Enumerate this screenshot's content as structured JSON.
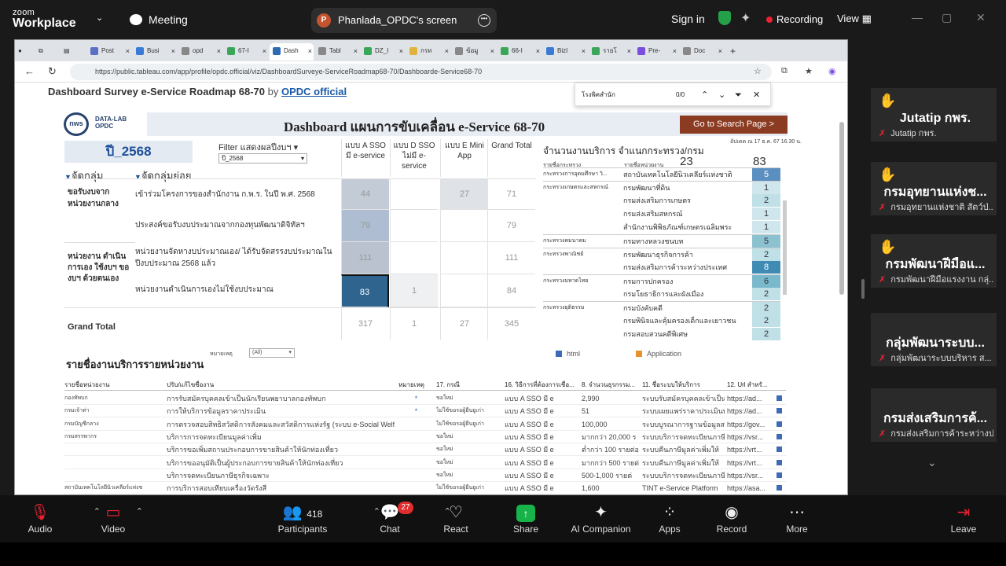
{
  "zoom": {
    "brand_top": "zoom",
    "brand_bottom": "Workplace",
    "meeting": "Meeting",
    "share_label": "Phanlada_OPDC's screen",
    "signin": "Sign in",
    "recording": "Recording",
    "view": "View"
  },
  "browser": {
    "tabs": [
      "Post",
      "Busi",
      "opd",
      "67-I",
      "Dash",
      "Tabl",
      "DZ_I",
      "กรท",
      "ข้อมู",
      "66-I",
      "BizI",
      "รายโ",
      "Pre-",
      "Doc"
    ],
    "url": "https://public.tableau.com/app/profile/opdc.official/viz/DashboardSurveye-ServiceRoadmap68-70/Dashboarde-Service68-70"
  },
  "viz": {
    "title": "Dashboard Survey e-Service Roadmap 68-70",
    "by": "by",
    "author": "OPDC official"
  },
  "find": {
    "query": "โรงพิคสำนัก",
    "count": "0/0"
  },
  "dash": {
    "logo": "nws",
    "logo_sub": "DATA-LAB\nOPDC",
    "title": "Dashboard แผนการขับเคลื่อน e-Service 68-70",
    "goto": "Go to Search Page >",
    "year": "ปี_2568",
    "filter_label": "Filter แสดงผลปีงบฯ",
    "filter_value": "ปี_2568",
    "grp1": "จัดกลุ่ม",
    "grp2": "จัดกลุ่มย่อย",
    "cols": [
      "แบบ A SSO มี e-service",
      "แบบ D SSO ไม่มี e-service",
      "แบบ E Mini App",
      "Grand Total"
    ],
    "rowgroups": [
      "ขอรับงบจาก หน่วยงานกลาง",
      "หน่วยงาน ดำเนินการเอง ใช้งบฯ ของบฯ ด้วยตนเอง"
    ],
    "rows": [
      {
        "label": "เข้าร่วมโครงการของสำนักงาน ก.พ.ร. ในปี พ.ศ. 2568",
        "a": "44",
        "d": "",
        "e": "27",
        "t": "71"
      },
      {
        "label": "ประสงค์ขอรับงบประมาณจากกองทุนพัฒนาดิจิทัลฯ",
        "a": "79",
        "d": "",
        "e": "",
        "t": "79"
      },
      {
        "label": "หน่วยงานจัดหางบประมาณเอง/ ได้รับจัดสรรงบประมาณในปีงบประมาณ 2568 แล้ว",
        "a": "111",
        "d": "",
        "e": "",
        "t": "111"
      },
      {
        "label": "หน่วยงานดำเนินการเองไม่ใช้งบประมาณ",
        "a": "83",
        "d": "1",
        "e": "",
        "t": "84"
      }
    ],
    "grand": {
      "label": "Grand Total",
      "a": "317",
      "d": "1",
      "e": "27",
      "t": "345"
    }
  },
  "right": {
    "title": "จำนวนงานบริการ จำแนกกระทรวง/กรม",
    "date": "อัปเดต ณ 17 ธ.ค. 67 16.30 น.",
    "h1": "รายชื่อกระทรวง",
    "h2": "รายชื่อหน่วยงาน",
    "n1": "23",
    "n2": "83",
    "rows": [
      {
        "m": "กระทรวงการอุดมศึกษา วิ...",
        "u": "สถาบันเทคโนโลยีนิวเคลียร์แห่งชาติ",
        "v": "5",
        "c": "#5b8fbf"
      },
      {
        "m": "กระทรวงเกษตรและสหกรณ์",
        "u": "กรมพัฒนาที่ดิน",
        "v": "1",
        "c": "#cfe6ec"
      },
      {
        "m": "",
        "u": "กรมส่งเสริมการเกษตร",
        "v": "2",
        "c": "#bfe0e6"
      },
      {
        "m": "",
        "u": "กรมส่งเสริมสหกรณ์",
        "v": "1",
        "c": "#cfe6ec"
      },
      {
        "m": "",
        "u": "สำนักงานพิพิธภัณฑ์เกษตรเฉลิมพระ",
        "v": "1",
        "c": "#cfe6ec"
      },
      {
        "m": "กระทรวงคมนาคม",
        "u": "กรมทางหลวงชนบท",
        "v": "5",
        "c": "#8cc2d0"
      },
      {
        "m": "กระทรวงพาณิชย์",
        "u": "กรมพัฒนาธุรกิจการค้า",
        "v": "2",
        "c": "#bfe0e6"
      },
      {
        "m": "",
        "u": "กรมส่งเสริมการค้าระหว่างประเทศ",
        "v": "8",
        "c": "#3f8bb4"
      },
      {
        "m": "กระทรวงมหาดไทย",
        "u": "กรมการปกครอง",
        "v": "6",
        "c": "#7ab8cc"
      },
      {
        "m": "",
        "u": "กรมโยธาธิการและผังเมือง",
        "v": "2",
        "c": "#bfe0e6"
      },
      {
        "m": "กระทรวงยุติธรรม",
        "u": "กรมบังคับคดี",
        "v": "2",
        "c": "#bfe0e6"
      },
      {
        "m": "",
        "u": "กรมพินิจและคุ้มครองเด็กและเยาวชน",
        "v": "2",
        "c": "#bfe0e6"
      },
      {
        "m": "",
        "u": "กรมสอบสวนคดีพิเศษ",
        "v": "2",
        "c": "#bfe0e6"
      }
    ],
    "legend": [
      "html",
      "Application"
    ],
    "legend_colors": [
      "#3f6ab5",
      "#e8912d"
    ]
  },
  "detail": {
    "title": "รายชื่องานบริการรายหน่วยงาน",
    "note": "หมายเหตุ",
    "note_sel": "(All)",
    "head": [
      "รายชื่อหน่วยงาน",
      "ปรับ/แก้ไขชื่องาน",
      "หมายเหตุ",
      "17. กรณี",
      "16. วิธีการที่ต้องการเชื่อ...",
      "8. จำนวนธุรกรรม...",
      "11. ชื่อระบบให้บริการ",
      "12. Url สำหรั..."
    ],
    "rows": [
      {
        "org": "กองทัพบก",
        "svc": "การรับสมัครบุคคลเข้าเป็นนักเรียนพยาบาลกองทัพบก",
        "note": "*",
        "c": "ขอใหม่",
        "way": "แบบ A  SSO  มี e",
        "n": "2,990",
        "sys": "ระบบรับสมัครบุคคลเข้าเป็น",
        "url": "https://ad..."
      },
      {
        "org": "กรมเจ้าท่า",
        "svc": "การให้บริการข้อมูลราคาประเมิน",
        "note": "*",
        "c": "ไม่ใช้ขอรอผู้ยืนยูเก่า",
        "way": "แบบ A  SSO  มี e",
        "n": "51",
        "sys": "ระบบเผยแพร่ราคาประเมินท",
        "url": "https://ad..."
      },
      {
        "org": "กรมบัญชีกลาง",
        "svc": "การตรวจสอบสิทธิสวัสดิการสังคมและสวัสดิการแห่งรัฐ (ระบบ e-Social Welfare)",
        "note": "",
        "c": "ไม่ใช้ขอรอผู้ยืนยูเก่า",
        "way": "แบบ A  SSO  มี e",
        "n": "100,000",
        "sys": "ระบบบูรณาการฐานข้อมูลสวั",
        "url": "https://gov..."
      },
      {
        "org": "กรมสรรพากร",
        "svc": "บริการการจดทะเบียนมูลค่าเพิ่ม",
        "note": "",
        "c": "ขอใหม่",
        "way": "แบบ A  SSO  มี e",
        "n": "มากกว่า 20,000 ร",
        "sys": "ระบบบริการจดทะเบียนภาษี",
        "url": "https://vsr..."
      },
      {
        "org": "",
        "svc": "บริการขอเพิ่มสถานประกอบการขายสินค้าให้นักท่องเที่ยว",
        "note": "",
        "c": "ขอใหม่",
        "way": "แบบ A  SSO  มี e",
        "n": "ต่ำกว่า 100 รายต่อ",
        "sys": "ระบบคืนภาษีมูลค่าเพิ่มให้",
        "url": "https://vrt..."
      },
      {
        "org": "",
        "svc": "บริการขออนุมัติเป็นผู้ประกอบการขายสินค้าให้นักท่องเที่ยว",
        "note": "",
        "c": "ขอใหม่",
        "way": "แบบ A  SSO  มี e",
        "n": "มากกว่า 500 รายต่",
        "sys": "ระบบคืนภาษีมูลค่าเพิ่มให้",
        "url": "https://vrt..."
      },
      {
        "org": "",
        "svc": "บริการจดทะเบียนภาษีธุรกิจเฉพาะ",
        "note": "",
        "c": "ขอใหม่",
        "way": "แบบ A  SSO  มี e",
        "n": "500-1,000 รายต่",
        "sys": "ระบบบริการจดทะเบียนภาษี",
        "url": "https://vsr..."
      },
      {
        "org": "สถาบันเทคโนโลยีนิวเคลียร์แห่งช",
        "svc": "การบริการสอบเทียบเครื่องวัดรังสี",
        "note": "",
        "c": "ไม่ใช้ขอรอผู้ยืนยูเก่า",
        "way": "แบบ A  SSO  มี e",
        "n": "1,600",
        "sys": "TINT e-Service Platform",
        "url": "https://asa..."
      }
    ]
  },
  "participants": [
    {
      "name": "Jutatip กพร.",
      "sub": "Jutatip กพร."
    },
    {
      "name": "กรมอุทยานแห่งช...",
      "sub": "กรมอุทยานแห่งชาติ สัตว์ป่..."
    },
    {
      "name": "กรมพัฒนาฝีมือแ...",
      "sub": "กรมพัฒนาฝีมือแรงงาน กลุ่..."
    },
    {
      "name": "กลุ่มพัฒนาระบบ...",
      "sub": "กลุ่มพัฒนาระบบบริหาร ส..."
    },
    {
      "name": "กรมส่งเสริมการค้...",
      "sub": "กรมส่งเสริมการค้าระหว่างป..."
    }
  ],
  "toolbar": {
    "audio": "Audio",
    "video": "Video",
    "participants": "Participants",
    "participants_count": "418",
    "chat": "Chat",
    "chat_badge": "27",
    "react": "React",
    "share": "Share",
    "ai": "AI Companion",
    "apps": "Apps",
    "record": "Record",
    "more": "More",
    "leave": "Leave"
  }
}
